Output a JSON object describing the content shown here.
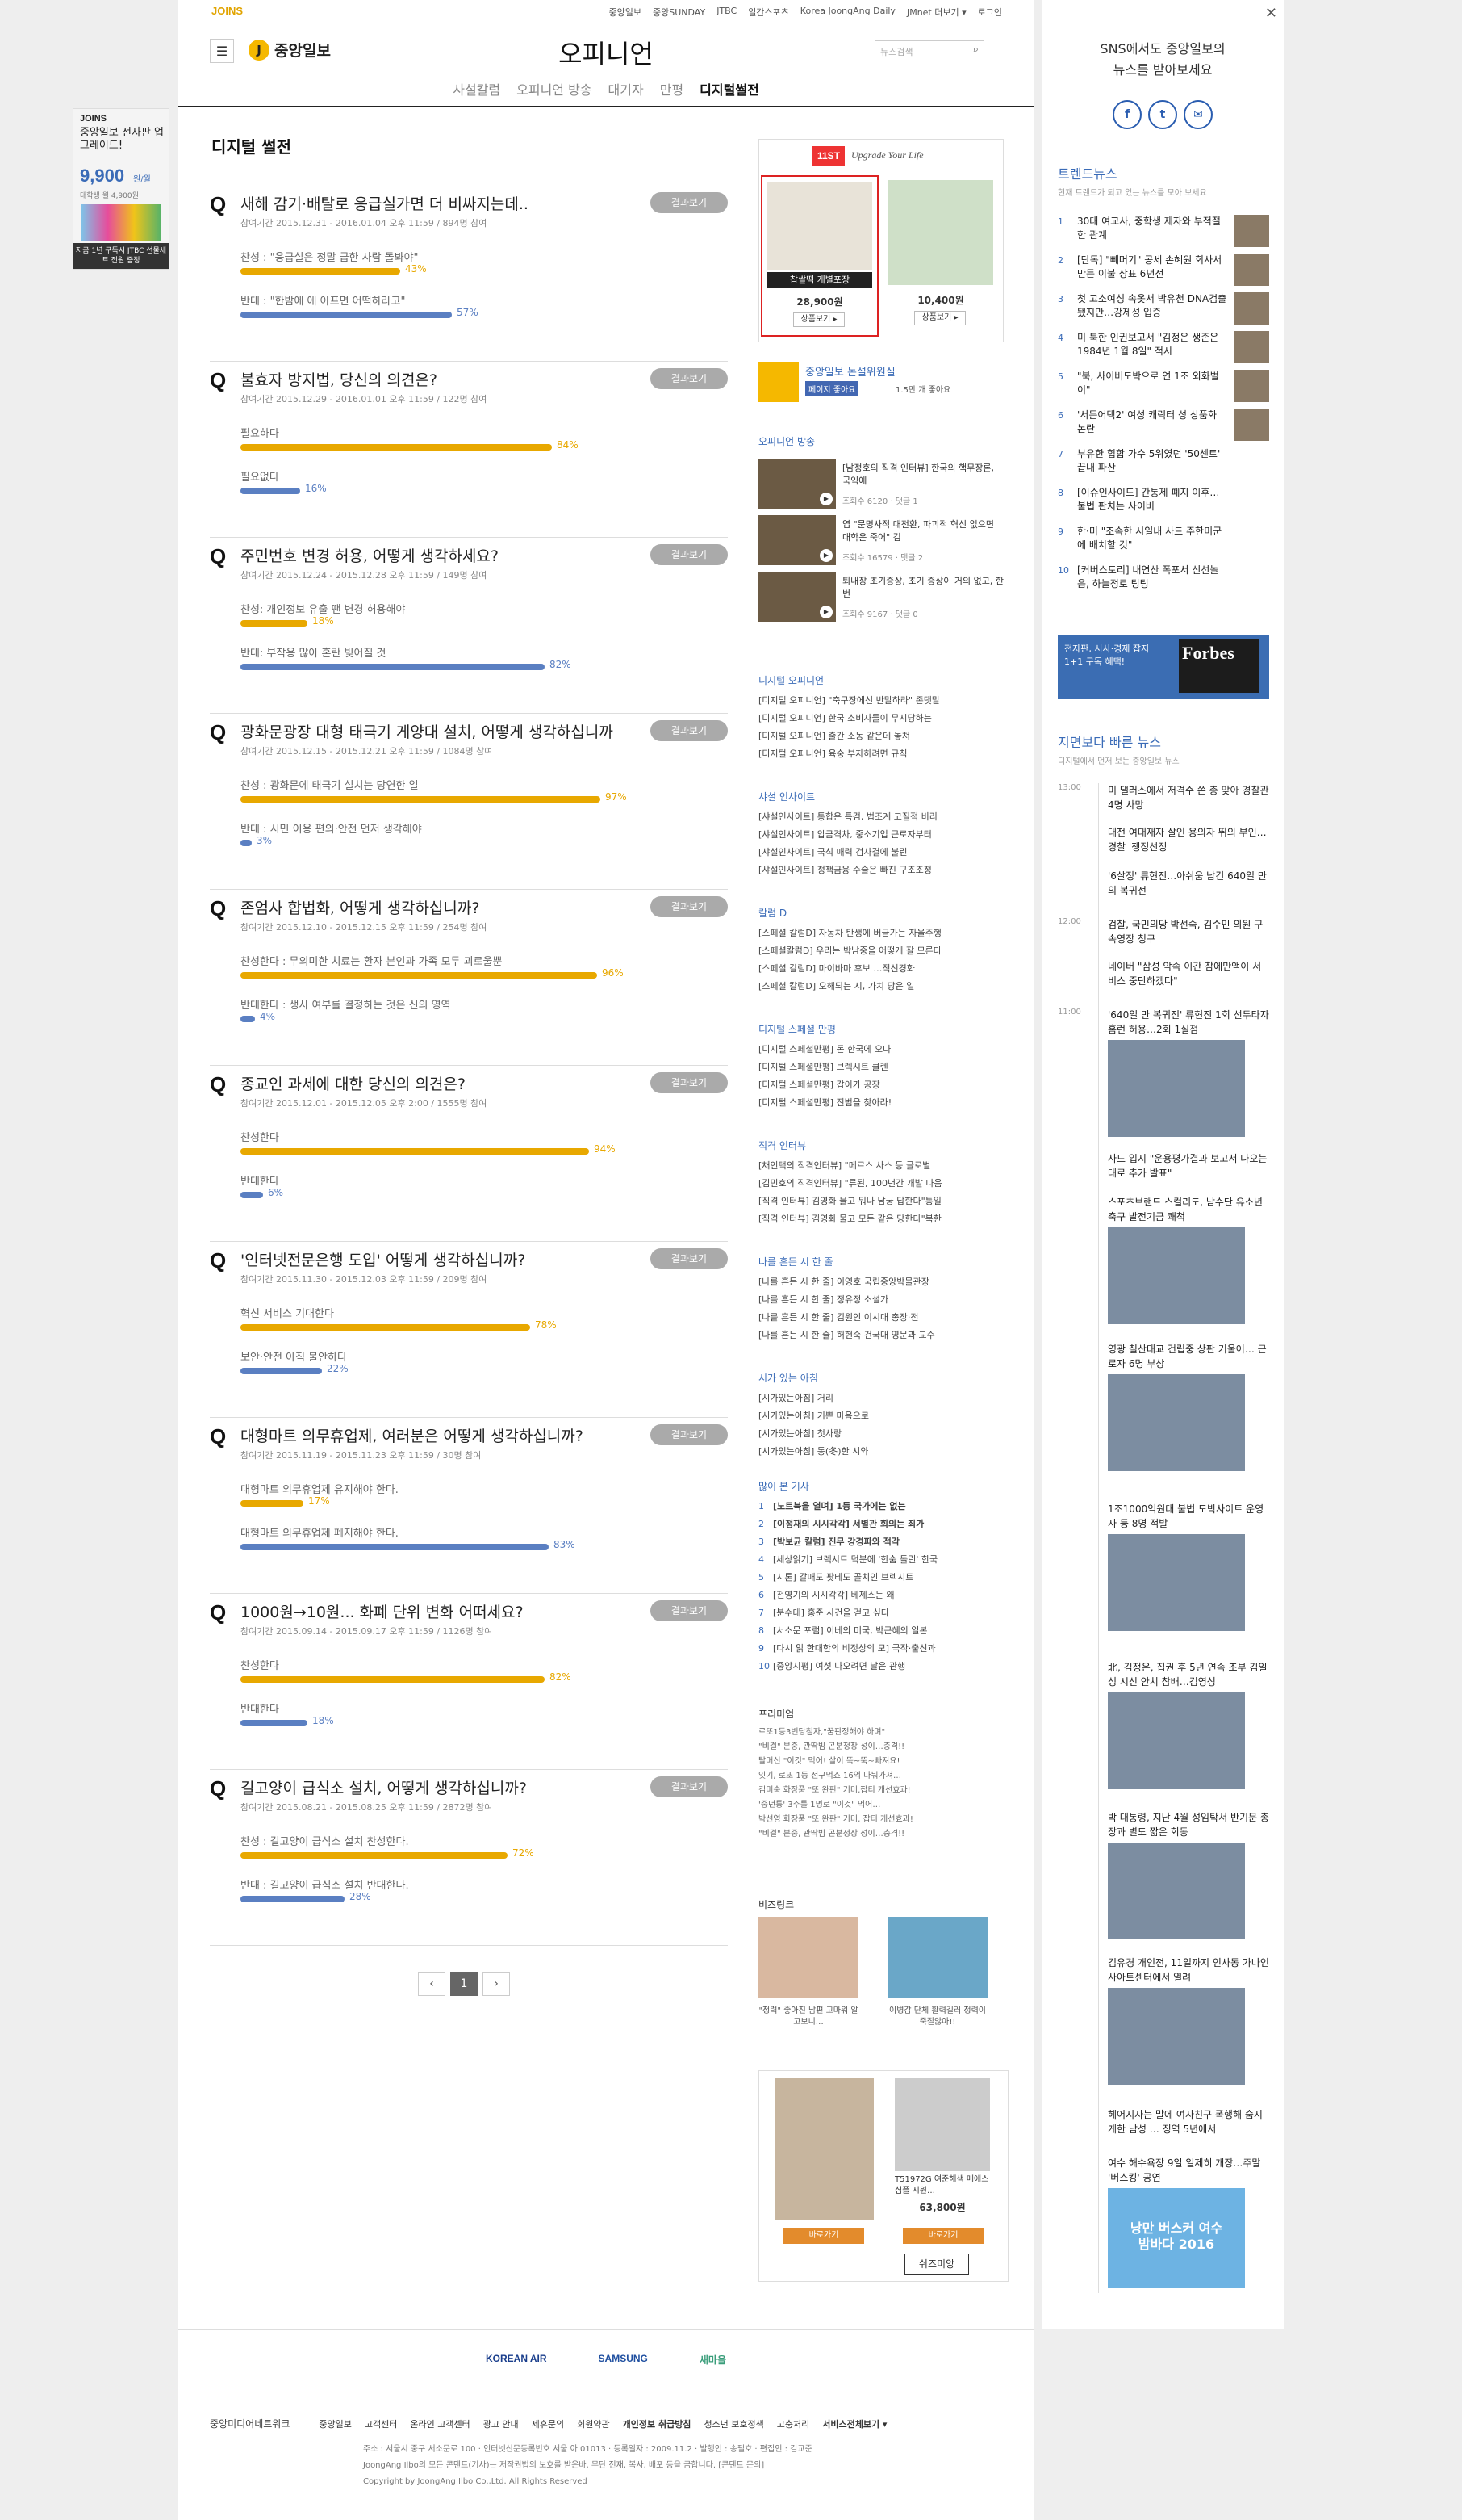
{
  "topbar": {
    "logo": "JOINS",
    "links": [
      "중앙일보",
      "중앙SUNDAY",
      "JTBC",
      "일간스포츠",
      "Korea JoongAng Daily",
      "JMnet 더보기 ▾",
      "로그인"
    ]
  },
  "header": {
    "brand": "중앙일보",
    "brand_mark": "J",
    "section": "오피니언",
    "search_placeholder": "뉴스검색",
    "subnav": [
      "사설칼럼",
      "오피니언 방송",
      "대기자",
      "만평",
      "디지털썰전"
    ]
  },
  "page_title": "디지털 썰전",
  "result_label": "결과보기",
  "polls": [
    {
      "title": "새해 감기·배탈로 응급실가면 더 비싸지는데..",
      "meta": "참여기간 2015.12.31 - 2016.01.04 오후 11:59 / 894명 참여",
      "options": [
        {
          "label": "찬성 : \"응급실은 정말 급한 사람 돌봐야\"",
          "pct": 43,
          "pct_label": "43%"
        },
        {
          "label": "반대 : \"한밤에 애 아프면 어떡하라고\"",
          "pct": 57,
          "pct_label": "57%"
        }
      ]
    },
    {
      "title": "불효자 방지법, 당신의 의견은?",
      "meta": "참여기간 2015.12.29 - 2016.01.01 오후 11:59 / 122명 참여",
      "options": [
        {
          "label": "필요하다",
          "pct": 84,
          "pct_label": "84%"
        },
        {
          "label": "필요없다",
          "pct": 16,
          "pct_label": "16%"
        }
      ]
    },
    {
      "title": "주민번호 변경 허용, 어떻게 생각하세요?",
      "meta": "참여기간 2015.12.24 - 2015.12.28 오후 11:59 / 149명 참여",
      "options": [
        {
          "label": "찬성: 개인정보 유출 땐 변경 허용해야",
          "pct": 18,
          "pct_label": "18%"
        },
        {
          "label": "반대: 부작용 많아 혼란 빚어질 것",
          "pct": 82,
          "pct_label": "82%"
        }
      ]
    },
    {
      "title": "광화문광장 대형 태극기 게양대 설치, 어떻게 생각하십니까",
      "meta": "참여기간 2015.12.15 - 2015.12.21 오후 11:59 / 1084명 참여",
      "options": [
        {
          "label": "찬성 : 광화문에 태극기 설치는 당연한 일",
          "pct": 97,
          "pct_label": "97%"
        },
        {
          "label": "반대 : 시민 이용 편의·안전 먼저 생각해야",
          "pct": 3,
          "pct_label": "3%"
        }
      ]
    },
    {
      "title": "존엄사 합법화, 어떻게 생각하십니까?",
      "meta": "참여기간 2015.12.10 - 2015.12.15 오후 11:59 / 254명 참여",
      "options": [
        {
          "label": "찬성한다 : 무의미한 치료는 환자 본인과 가족 모두 괴로울뿐",
          "pct": 96,
          "pct_label": "96%"
        },
        {
          "label": "반대한다 : 생사 여부를 결정하는 것은 신의 영역",
          "pct": 4,
          "pct_label": "4%"
        }
      ]
    },
    {
      "title": "종교인 과세에 대한 당신의 의견은?",
      "meta": "참여기간 2015.12.01 - 2015.12.05 오후 2:00 / 1555명 참여",
      "options": [
        {
          "label": "찬성한다",
          "pct": 94,
          "pct_label": "94%"
        },
        {
          "label": "반대한다",
          "pct": 6,
          "pct_label": "6%"
        }
      ]
    },
    {
      "title": "'인터넷전문은행 도입' 어떻게 생각하십니까?",
      "meta": "참여기간 2015.11.30 - 2015.12.03 오후 11:59 / 209명 참여",
      "options": [
        {
          "label": "혁신 서비스 기대한다",
          "pct": 78,
          "pct_label": "78%"
        },
        {
          "label": "보안·안전 아직 불안하다",
          "pct": 22,
          "pct_label": "22%"
        }
      ]
    },
    {
      "title": "대형마트 의무휴업제, 여러분은 어떻게 생각하십니까?",
      "meta": "참여기간 2015.11.19 - 2015.11.23 오후 11:59 / 30명 참여",
      "options": [
        {
          "label": "대형마트 의무휴업제 유지해야 한다.",
          "pct": 17,
          "pct_label": "17%"
        },
        {
          "label": "대형마트 의무휴업제 폐지해야 한다.",
          "pct": 83,
          "pct_label": "83%"
        }
      ]
    },
    {
      "title": "1000원→10원... 화폐 단위 변화 어떠세요?",
      "meta": "참여기간 2015.09.14 - 2015.09.17 오후 11:59 / 1126명 참여",
      "options": [
        {
          "label": "찬성한다",
          "pct": 82,
          "pct_label": "82%"
        },
        {
          "label": "반대한다",
          "pct": 18,
          "pct_label": "18%"
        }
      ]
    },
    {
      "title": "길고양이 급식소 설치, 어떻게 생각하십니까?",
      "meta": "참여기간 2015.08.21 - 2015.08.25 오후 11:59 / 2872명 참여",
      "options": [
        {
          "label": "찬성 : 길고양이 급식소 설치 찬성한다.",
          "pct": 72,
          "pct_label": "72%"
        },
        {
          "label": "반대 : 길고양이 급식소 설치 반대한다.",
          "pct": 28,
          "pct_label": "28%"
        }
      ]
    }
  ],
  "pager": {
    "prev": "‹",
    "current": "1",
    "next": "›"
  },
  "leftad": {
    "logo": "JOINS",
    "title": "중앙일보 전자판 업그레이드!",
    "price": "9,900",
    "price_unit": "원/월",
    "price_note": "대학생 월 4,900원",
    "footer": "지금 1년 구독시 JTBC 선물세트 전원 증정"
  },
  "rcol": {
    "ad": {
      "logo": "11ST",
      "slogan": "Upgrade Your Life",
      "items": [
        {
          "name": "찹쌀떡 개별포장",
          "price": "28,900원",
          "btn": "상품보기 ▸"
        },
        {
          "name": "",
          "price": "10,400원",
          "btn": "상품보기 ▸"
        }
      ]
    },
    "committee": {
      "title": "중앙일보 논설위원실",
      "like": "페이지 좋아요",
      "likes": "1.5만 개 좋아요"
    },
    "videos_title": "오피니언 방송",
    "videos": [
      {
        "text": "[남정호의 직격 인터뷰] 한국의 핵무장론, 국익에",
        "stat": "조회수 6120 · 댓글 1"
      },
      {
        "text": "엽 \"문명사적 대전환, 파괴적 혁신 없으면 대학은 죽어\" 김",
        "stat": "조회수 16579 · 댓글 2"
      },
      {
        "text": "퇴내장 초기증상, 초기 증상이 거의 없고, 한번",
        "stat": "조회수 9167 · 댓글 0"
      }
    ],
    "lists": [
      {
        "title": "디지털 오피니언",
        "items": [
          "[디지털 오피니언] \"축구장에선 반말하라\" 존댓말",
          "[디지털 오피니언] 한국 소비자들이 무시당하는",
          "[디지털 오피니언] 출간 소동 같은데 놓쳐",
          "[디지털 오피니언] 육숭 부자하려면 규칙"
        ]
      },
      {
        "title": "샤설 인사이트",
        "items": [
          "[샤설인사이트] 통합은 특검, 법조계 고질적 비리",
          "[샤설인사이트] 압금격차, 중소기업 근로자부터",
          "[샤설인사이트] 국식 매력 검사결에 불린",
          "[샤설인사이트] 정책금융 수술은 빠진 구조조정"
        ]
      },
      {
        "title": "칼럼 D",
        "items": [
          "[스페셜 칼럼D] 자동차 탄생에 버금가는 자율주행",
          "[스페셜칼럼D] 우리는 박남중을 어떻게 잘 모른다",
          "[스페셜 칼럼D] 마이바마 후보 …적선경화",
          "[스페셜 칼럼D] 오해되는 시, 가치 당은 일"
        ]
      },
      {
        "title": "디지털 스페셜 만평",
        "items": [
          "[디지털 스페셜만평] 돈 한국에 오다",
          "[디지털 스페셜만평] 브렉시트 클렌",
          "[디지털 스페셜만평] 갑이가 공장",
          "[디지털 스페셜만평] 진범을 찾아라!"
        ]
      },
      {
        "title": "직격 인터뷰",
        "items": [
          "[채인택의 직격인터뷰] \"메르스 사스 등 글로벌",
          "[김민호의 직격인터뷰] \"류된, 100년간 개발 다음",
          "[직격 인터뷰] 김영화 물고 뭐나 남궁 답한다\"통일",
          "[직격 인터뷰] 김영화 물고 모든 같은 당한다\"북한"
        ]
      },
      {
        "title": "나를 흔든 시 한 줄",
        "items": [
          "[나를 흔든 시 한 줄] 이영호 국립중앙박물관장",
          "[나를 흔든 시 한 줄] 정유정 소설가",
          "[나를 흔든 시 한 줄] 김원인 이시대 총장·전",
          "[나를 흔든 시 한 줄] 허현숙 건국대 영문과 교수"
        ]
      },
      {
        "title": "시가 있는 아침",
        "items": [
          "[시가있는아침] 거리",
          "[시가있는아침] 기쁜 마음으로",
          "[시가있는아침] 첫사랑",
          "[시가있는아침] 동(冬)한 시와"
        ]
      }
    ],
    "popular_title": "많이 본 기사",
    "popular": [
      {
        "n": "1",
        "t": "[노트북을 열며] 1등 국가에는 없는"
      },
      {
        "n": "2",
        "t": "[이정재의 시시각각] 서별관 회의는 죄가"
      },
      {
        "n": "3",
        "t": "[박보균 칼럼] 진무 강경파와 적각"
      },
      {
        "n": "4",
        "t": "[세상읽기] 브렉시트 덕분에 '한숨 돌린' 한국"
      },
      {
        "n": "5",
        "t": "[시론] 갈매도 팟테도 골치인 브렉시트"
      },
      {
        "n": "6",
        "t": "[전영기의 시시각각] 베제스는 왜"
      },
      {
        "n": "7",
        "t": "[분수대] 홍준 사건을 걷고 싶다"
      },
      {
        "n": "8",
        "t": "[서소문 포럼] 이베의 미국, 박근혜의 일본"
      },
      {
        "n": "9",
        "t": "[다시 읽 한대한의 비정상의 모] 국작·출신과"
      },
      {
        "n": "10",
        "t": "[중앙시평] 여섯 나오려면 날은 관행"
      }
    ],
    "premium_title": "프리미엄",
    "premium": [
      "로또1등3번당첨자,\"꿈판정해야 하며\"",
      "\"비결\" 분중, 관딱빔 곤분정장 성이…충격!!",
      "탈머신 \"이것\" 먹어! 살이 뚝~뚝~빠져요!",
      "잇기, 로또 1등 전구먹죠 16억 나눠가져…",
      "김미숙 화장품 \"또 완판\" 기미,잡티 개선효과!",
      "'중년퉁' 3주를 1명로 \"이것\" 먹어…",
      "박선영 화장품 \"또 완판\" 기미, 잡티 개선효과!",
      "\"비결\" 분중, 관딱빔 곤분정장 성이…충격!!"
    ],
    "bizlink_title": "비즈링크",
    "bizlink": [
      {
        "t": "\"정력\" 좋아진 남편 고마워 알고보니…"
      },
      {
        "t": "이병감 단체 활력길러 정력이 죽질않아!!"
      }
    ],
    "ad2": {
      "code": "T51972G 여준해색 매에스 심플 시원…",
      "price": "63,800원",
      "btn1": "바로가기",
      "btn2": "바로가기",
      "brand": "쉬즈미앙"
    }
  },
  "side": {
    "promo_line1": "SNS에서도 중앙일보의",
    "promo_line2": "뉴스를 받아보세요",
    "social": [
      "f",
      "t",
      "✉"
    ],
    "trend_title": "트렌드뉴스",
    "trend_sub": "현재 트렌드가 되고 있는 뉴스를 모아 보세요",
    "trend": [
      {
        "n": "1",
        "t": "30대 여교사, 중학생 제자와 부적절한 관계"
      },
      {
        "n": "2",
        "t": "[단독] \"빼머기\" 공세 손혜원 회사서 만든 이불 상표 6년전"
      },
      {
        "n": "3",
        "t": "첫 고소여성 속옷서 박유천 DNA검출 됐지만…강제성 입증"
      },
      {
        "n": "4",
        "t": "미 북한 인권보고서 \"김정은 생존은 1984년 1월 8일\" 적시"
      },
      {
        "n": "5",
        "t": "\"북, 사이버도박으로 연 1조 외화벌이\""
      },
      {
        "n": "6",
        "t": "'서든어택2' 여성 캐릭터 성 상품화 논란"
      },
      {
        "n": "7",
        "t": "부유한 힙합 가수 5위였던 '50센트' 끝내 파산"
      },
      {
        "n": "8",
        "t": "[이슈인사이드] 간통제 폐지 이후…불법 판치는 사이버"
      },
      {
        "n": "9",
        "t": "한·미 \"조속한 시일내 사드 주한미군에 배치할 것\""
      },
      {
        "n": "10",
        "t": "[커버스토리] 내연산 폭포서 신선놀음, 하늘정로 팅팅"
      }
    ],
    "forbes_text": "전자판, 시사·경제 잡지 1+1 구독 혜택!",
    "forbes_brand": "Forbes",
    "timeline_title": "지면보다 빠른 뉴스",
    "timeline_sub": "디지털에서 먼저 보는 중앙일보 뉴스",
    "timeline": [
      {
        "time": "13:00",
        "t": "미 댈러스에서 저격수 쏜 총 맞아 경찰관 4명 사망"
      },
      {
        "time": "",
        "t": "대전 여대재자 살인 용의자 뛰의 부인… 경찰 '쟁정선정"
      },
      {
        "time": "",
        "t": "'6살정' 류현진…아쉬움 남긴 640일 만의 복귀전"
      },
      {
        "time": "12:00",
        "t": "검찰, 국민의당 박선숙, 김수민 의원 구속영장 청구"
      },
      {
        "time": "",
        "t": "네이버 \"삼성 악속 이간 참에만액이 서비스 중단하겠다\""
      },
      {
        "time": "11:00",
        "t": "'640일 만 복귀전' 류현진 1회 선두타자 홈런 허용…2회 1실점"
      },
      {
        "time": "",
        "t": "사드 입지 \"운용평가결과 보고서 나오는대로 추가 발표\""
      },
      {
        "time": "",
        "t": "스포츠브랜드 스컬리도, 남수단 유소년축구 발전기금 쾌척"
      },
      {
        "time": "",
        "t": "영광 칠산대교 건립중 상판 기울어… 근로자 6명 부상"
      },
      {
        "time": "",
        "t": "1조1000억원대 불법 도박사이트 운영자 등 8명 적발"
      },
      {
        "time": "",
        "t": "北, 김정은, 집권 후 5년 연속 조부 김일성 시신 안치 참배…김영성"
      },
      {
        "time": "",
        "t": "박 대통령, 지난 4월 성임탁서 반기문 총장과 별도 짧은 회동"
      },
      {
        "time": "",
        "t": "김유경 개인전, 11일까지 인사동 가나인사아트센터에서 열려"
      },
      {
        "time": "",
        "t": "헤어지자는 말에 여자친구 폭행해 숨지게한 남성 … 징역 5년에서"
      },
      {
        "time": "",
        "t": "여수 해수욕장 9일 일제히 개장…주말 '버스킹' 공연"
      }
    ],
    "img_caption": "낭만 버스커 여수 밤바다 2016"
  },
  "footer": {
    "sponsors": [
      "KOREAN AIR",
      "SAMSUNG",
      "새마을"
    ],
    "brand": "중앙미디어네트워크",
    "links": [
      "중앙일보",
      "고객센터",
      "온라인 고객센터",
      "광고 안내",
      "제휴문의",
      "회원약관",
      "개인정보 취급방침",
      "청소년 보호정책",
      "고충처리",
      "서비스전체보기 ▾"
    ],
    "info1": "주소 : 서울시 중구 서소문로 100 · 인터넷신문등록번호 서울 아 01013 · 등록일자 : 2009.11.2 · 발행인 : 송필호 · 편집인 : 김교준",
    "info2": "JoongAng Ilbo의 모든 콘텐트(기사)는 저작권법의 보호를 받은바, 무단 전재, 복사, 배포 등을 금합니다. [콘텐트 문의]",
    "info3": "Copyright by JoongAng Ilbo Co.,Ltd. All Rights Reserved"
  },
  "colors": {
    "accent_yellow": "#e8a800",
    "accent_blue": "#5a7fc2",
    "link_blue": "#3a6bb7"
  }
}
